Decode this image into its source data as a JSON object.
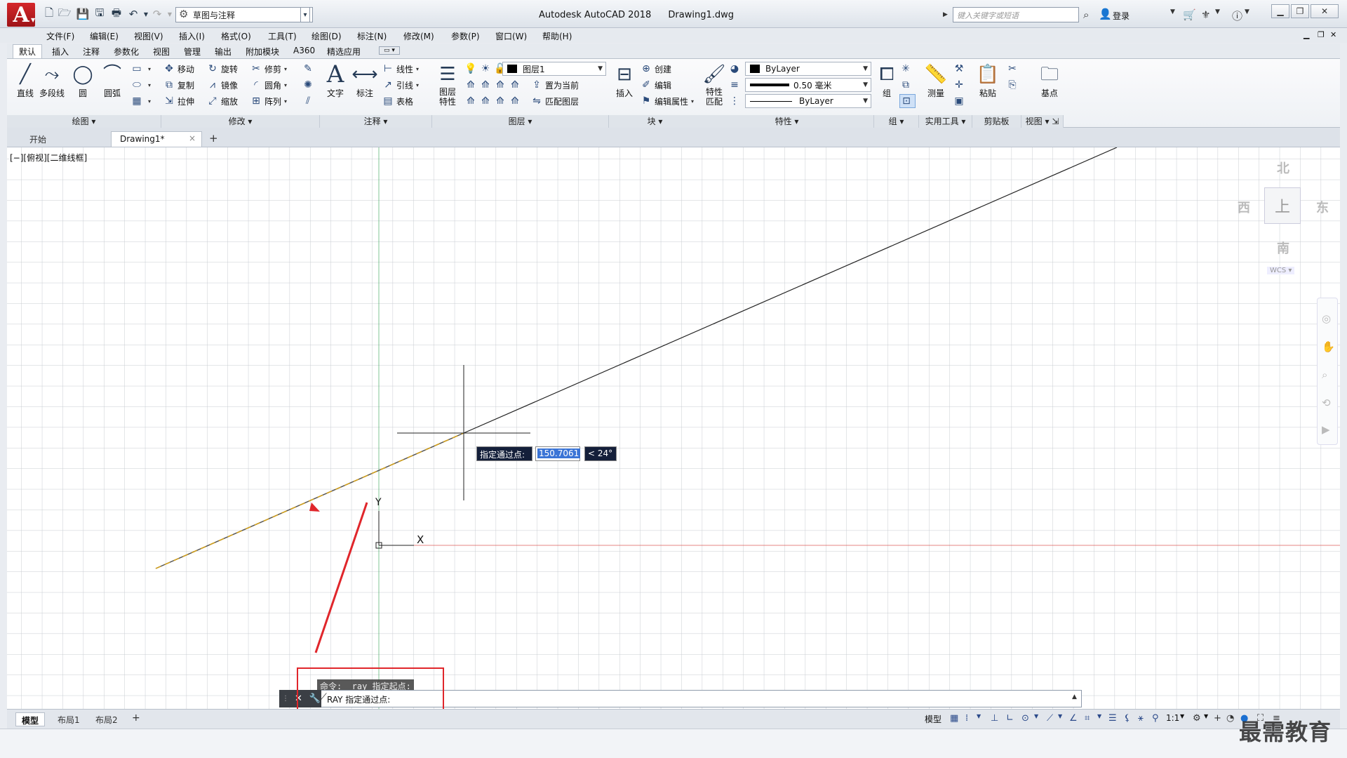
{
  "titlebar": {
    "app_name": "Autodesk AutoCAD 2018",
    "file_name": "Drawing1.dwg",
    "workspace": "草图与注释",
    "search_placeholder": "键入关键字或短语",
    "login": "登录",
    "logo": "A"
  },
  "menu": [
    "文件(F)",
    "编辑(E)",
    "视图(V)",
    "插入(I)",
    "格式(O)",
    "工具(T)",
    "绘图(D)",
    "标注(N)",
    "修改(M)",
    "参数(P)",
    "窗口(W)",
    "帮助(H)"
  ],
  "ribbon_tabs": [
    "默认",
    "插入",
    "注释",
    "参数化",
    "视图",
    "管理",
    "输出",
    "附加模块",
    "A360",
    "精选应用"
  ],
  "ribbon": {
    "draw": {
      "title": "绘图",
      "line": "直线",
      "polyline": "多段线",
      "circle": "圆",
      "arc": "圆弧"
    },
    "modify": {
      "title": "修改",
      "move": "移动",
      "rotate": "旋转",
      "trim": "修剪",
      "copy": "复制",
      "mirror": "镜像",
      "fillet": "圆角",
      "stretch": "拉伸",
      "scale": "缩放",
      "array": "阵列"
    },
    "annotation": {
      "title": "注释",
      "text": "文字",
      "dimension": "标注",
      "linear": "线性",
      "leader": "引线",
      "table": "表格"
    },
    "layers": {
      "title": "图层",
      "layer_props": "图层\n特性",
      "current_layer": "图层1",
      "set_current": "置为当前",
      "match_layer": "匹配图层"
    },
    "block": {
      "title": "块",
      "insert": "插入",
      "create": "创建",
      "edit": "编辑",
      "edit_attr": "编辑属性"
    },
    "properties": {
      "title": "特性",
      "match": "特性\n匹配",
      "color": "ByLayer",
      "lineweight": "0.50 毫米",
      "linetype": "ByLayer"
    },
    "groups": {
      "title": "组",
      "group": "组"
    },
    "utilities": {
      "title": "实用工具",
      "measure": "测量"
    },
    "clipboard": {
      "title": "剪贴板",
      "paste": "粘贴"
    },
    "view": {
      "title": "视图",
      "base": "基点"
    }
  },
  "file_tabs": [
    "开始",
    "Drawing1*"
  ],
  "viewport_label": "[−][俯视][二维线框]",
  "viewcube": {
    "north": "北",
    "south": "南",
    "east": "东",
    "west": "西",
    "top": "上",
    "wcs": "WCS"
  },
  "ucs": {
    "x": "X",
    "y": "Y"
  },
  "dynamic_input": {
    "prompt": "指定通过点:",
    "distance": "150.7061",
    "angle": "< 24°"
  },
  "command": {
    "history": "命令: _ray 指定起点:",
    "current": "RAY 指定通过点:"
  },
  "layout_tabs": [
    "模型",
    "布局1",
    "布局2"
  ],
  "status": {
    "model": "模型",
    "scale": "1:1"
  },
  "watermark": "最需教育",
  "colors": {
    "accent_red": "#e0262b",
    "ucs_x_axis": "#d9534f",
    "ucs_y_axis": "#2e9e4f",
    "grid": "#c8ccd2",
    "ray": "#222222",
    "preview": "#d4a017"
  }
}
